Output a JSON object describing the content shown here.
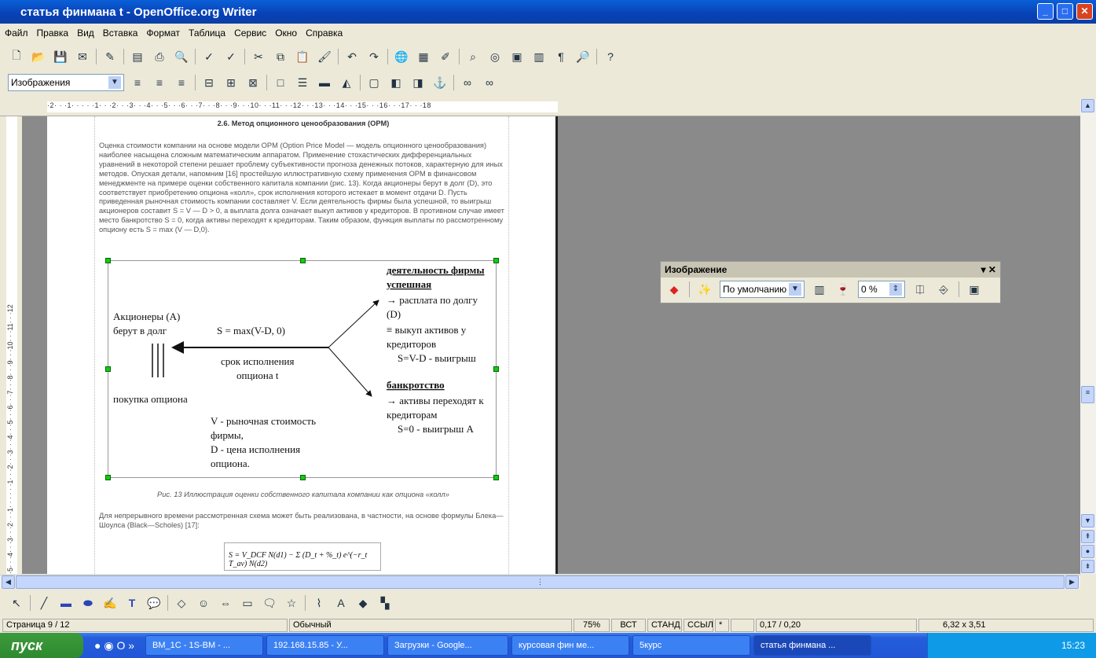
{
  "window": {
    "title": "статья  финмана t - OpenOffice.org Writer",
    "minimize": "_",
    "maximize": "□",
    "close": "✕"
  },
  "menu": [
    "Файл",
    "Правка",
    "Вид",
    "Вставка",
    "Формат",
    "Таблица",
    "Сервис",
    "Окно",
    "Справка"
  ],
  "format_toolbar": {
    "style_value": "Изображения"
  },
  "ruler": {
    "scale": "·2· · ·1· · · · ·1· · ·2· · ·3· · ·4· · ·5· · ·6· · ·7· · ·8· · ·9· · ·10· · ·11· · ·12· · ·13· · ·14· · ·15· · ·16· · ·17· · ·18"
  },
  "vruler": {
    "scale": "·5· · ·4· · ·3· · ·2· · ·1· · · · · ·1· · ·2· · ·3· · ·4· · ·5· · ·6· · ·7· · ·8· · ·9· · ·10· · ·11· · ·12"
  },
  "document": {
    "heading": "2.6. Метод опционного ценообразования (OPM)",
    "paragraph1": "Оценка стоимости компании на основе модели OPM (Option Price Model — модель опционного ценообразования) наиболее насыщена сложным математическим аппаратом. Применение стохастических дифференциальных уравнений в некоторой степени решает проблему субъективности прогноза денежных потоков, характерную для иных методов. Опуская детали, напомним [16] простейшую иллюстративную схему применения OPM в финансовом менеджменте на примере оценки собственного капитала компании (рис. 13). Когда акционеры берут в долг (D), это соответствует приобретению опциона «колл», срок исполнения которого истекает в момент отдачи D. Пусть приведенная рыночная стоимость компании составляет V. Если деятельность фирмы была успешной, то выигрыш акционеров составит S = V — D > 0, а выплата долга означает выкуп активов у кредиторов. В противном случае имеет место банкротство S = 0, когда активы переходят к кредиторам. Таким образом, функция выплаты по рассмотренному опциону есть S = max (V — D,0).",
    "figure": {
      "left1": "Акционеры (А)",
      "left2": "берут в долг",
      "formula": "S = max(V-D, 0)",
      "term1": "срок исполнения",
      "term2": "опциона t",
      "buy": "покупка опциона",
      "v1": "V - рыночная стоимость",
      "v2": "фирмы,",
      "v3": "D - цена исполнения",
      "v4": "опциона.",
      "r1": "деятельность фирмы",
      "r2": "успешная",
      "r3": "→ расплата по долгу",
      "r4": "(D)",
      "r5": "≡ выкуп активов у",
      "r6": "кредиторов",
      "r7": "S=V-D  - выигрыш",
      "r8": "банкротство",
      "r9": "→ активы переходят к",
      "r10": "кредиторам",
      "r11": "S=0 - выигрыш А"
    },
    "caption": "Рис. 13 Иллюстрация оценки собственного капитала компании как опциона «колл»",
    "paragraph2": "Для непрерывного времени рассмотренная схема может быть реализована, в частности, на основе формулы Блека—Шоулса (Black—Scholes) [17]:",
    "formula": "S = V_DCF N(d1) − Σ (D_t + %_t) e^(−r_t T_av) N(d2)"
  },
  "image_toolbar": {
    "title": "Изображение",
    "filter_mode": "По умолчанию",
    "transparency": "0 %"
  },
  "status": {
    "page": "Страница  9 / 12",
    "style": "Обычный",
    "zoom": "75%",
    "insert": "ВСТ",
    "select": "СТАНД",
    "link": "ССЫЛ",
    "modified": "*",
    "position": "0,17 / 0,20",
    "size": "6,32 x 3,51"
  },
  "taskbar": {
    "start": "пуск",
    "tasks": [
      "BM_1C - 1S-BM - ...",
      "192.168.15.85 - У...",
      "Загрузки - Google...",
      "курсовая фин ме...",
      "5курс",
      "статья  финмана ..."
    ],
    "clock": "15:23"
  }
}
